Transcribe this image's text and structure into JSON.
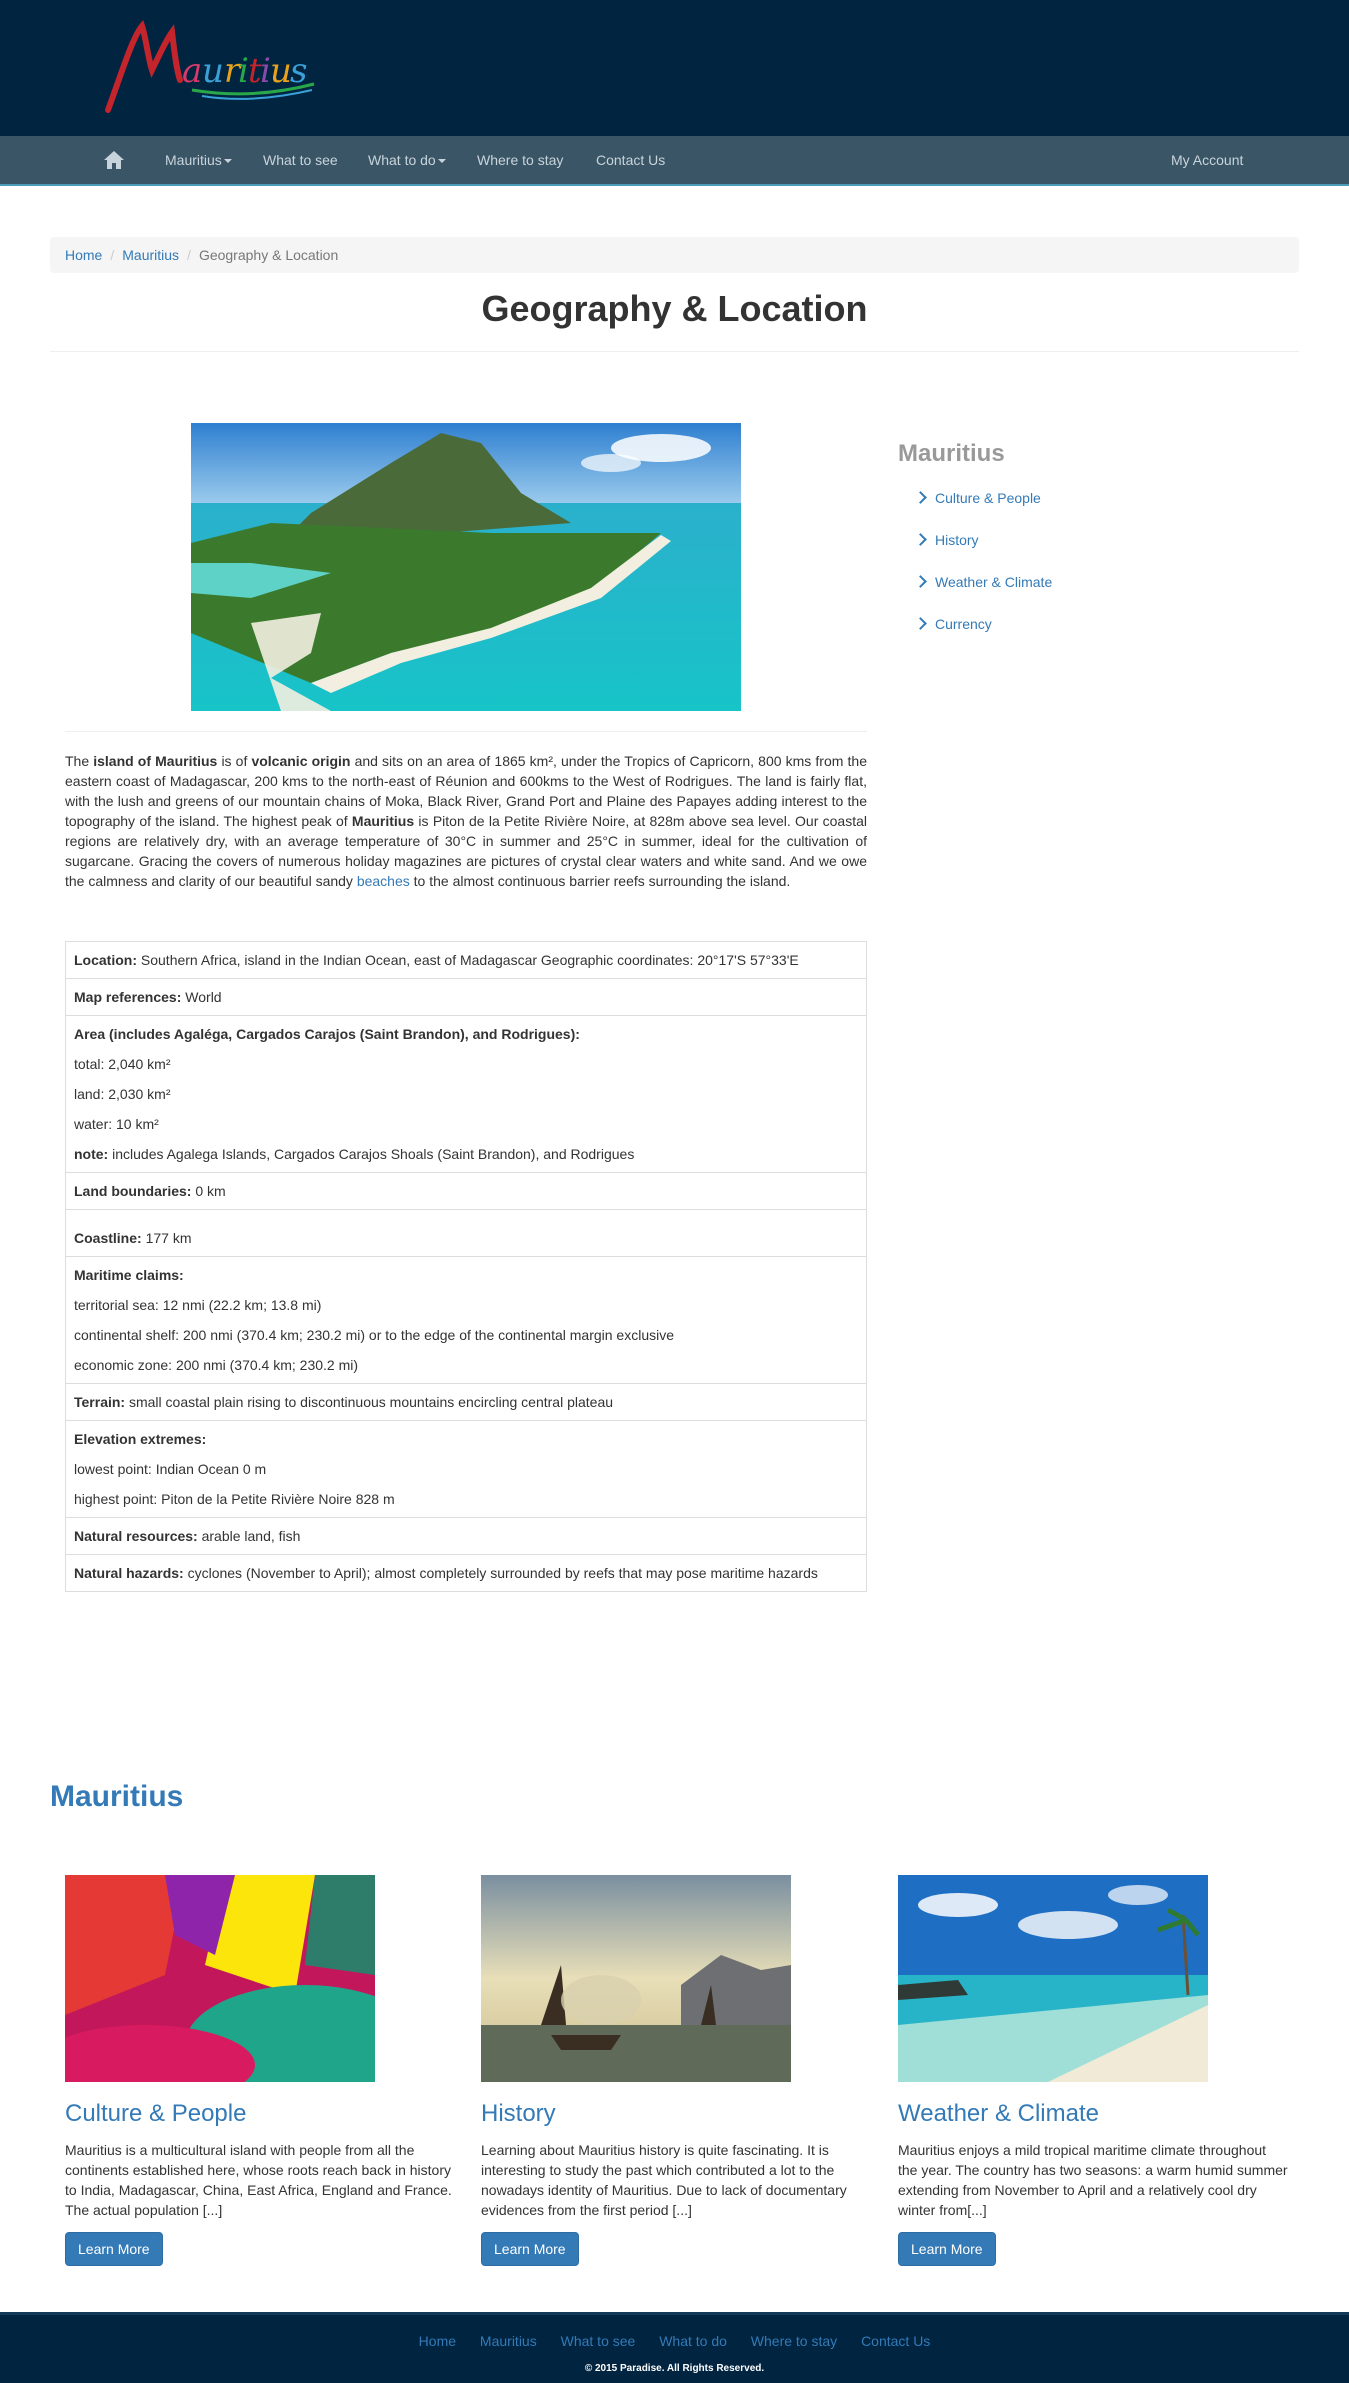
{
  "header": {
    "logo_text": "Mauritius"
  },
  "nav": {
    "items": [
      {
        "label": "Mauritius"
      },
      {
        "label": "What to see"
      },
      {
        "label": "What to do"
      },
      {
        "label": "Where to stay"
      },
      {
        "label": "Contact Us"
      }
    ],
    "account_label": "My Account"
  },
  "breadcrumb": {
    "items": [
      "Home",
      "Mauritius"
    ],
    "active": "Geography & Location",
    "separator": "/"
  },
  "page_title": "Geography & Location",
  "intro": {
    "p1": "The ",
    "b1": "island of Mauritius",
    "p2": " is of ",
    "b2": "volcanic origin",
    "p3": " and sits on an area of 1865 km², under the Tropics of Capricorn, 800 kms from the eastern coast of Madagascar, 200 kms to the north-east of Réunion and 600kms to the West of Rodrigues. The land is fairly flat, with the lush and greens of our mountain chains of Moka, Black River, Grand Port and Plaine des Papayes adding interest to the topography of the island. The highest peak of ",
    "b3": "Mauritius",
    "p4": " is Piton de la Petite Rivière Noire, at 828m above sea level. Our coastal regions are relatively dry, with an average temperature of 30°C in summer and 25°C in summer, ideal for the cultivation of sugarcane. Gracing the covers of numerous holiday magazines are pictures of crystal clear waters and white sand. And we owe the calmness and clarity of our beautiful sandy ",
    "link": "beaches",
    "p5": " to the almost continuous barrier reefs surrounding the island."
  },
  "facts": {
    "location": {
      "label": "Location:",
      "value": " Southern Africa, island in the Indian Ocean, east of Madagascar Geographic coordinates: 20°17'S 57°33'E"
    },
    "map_refs": {
      "label": "Map references:",
      "value": " World"
    },
    "area": {
      "label": "Area (includes Agaléga, Cargados Carajos (Saint Brandon), and Rodrigues):",
      "total": "total: 2,040 km²",
      "land": "land: 2,030 km²",
      "water": "water: 10 km²",
      "note_label": "note:",
      "note_value": " includes Agalega Islands, Cargados Carajos Shoals (Saint Brandon), and Rodrigues"
    },
    "land_boundaries": {
      "label": "Land boundaries:",
      "value": " 0 km"
    },
    "coastline": {
      "label": "Coastline:",
      "value": " 177 km"
    },
    "maritime": {
      "label": "Maritime claims:",
      "territorial": "territorial sea: 12 nmi (22.2 km; 13.8 mi)",
      "shelf": "continental shelf: 200 nmi (370.4 km; 230.2 mi) or to the edge of the continental margin exclusive",
      "economic": "economic zone: 200 nmi (370.4 km; 230.2 mi)"
    },
    "terrain": {
      "label": "Terrain:",
      "value": " small coastal plain rising to discontinuous mountains encircling central plateau"
    },
    "elevation": {
      "label": "Elevation extremes:",
      "lowest": "lowest point: Indian Ocean 0 m",
      "highest": "highest point: Piton de la Petite Rivière Noire 828 m"
    },
    "resources": {
      "label": "Natural resources:",
      "value": " arable land, fish"
    },
    "hazards": {
      "label": "Natural hazards:",
      "value": " cyclones (November to April); almost completely surrounded by reefs that may pose maritime hazards"
    }
  },
  "sidebar": {
    "title": "Mauritius",
    "links": [
      "Culture & People",
      "History",
      "Weather & Climate",
      "Currency"
    ]
  },
  "section": {
    "title": "Mauritius",
    "cards": [
      {
        "title": "Culture & People",
        "text": "Mauritius is a multicultural island with people from all the continents established here, whose roots reach back in history to India, Madagascar, China, East Africa, England and France. The actual population [...]",
        "button": "Learn More"
      },
      {
        "title": "History",
        "text": "Learning about Mauritius history is quite fascinating. It is interesting to study the past which contributed a lot to the nowadays identity of Mauritius. Due to lack of documentary evidences from the first period [...]",
        "button": "Learn More"
      },
      {
        "title": "Weather & Climate",
        "text": "Mauritius enjoys a mild tropical maritime climate throughout the year. The country has two seasons: a warm humid summer extending from November to April and a relatively cool dry winter from[...]",
        "button": "Learn More"
      }
    ]
  },
  "footer": {
    "links": [
      "Home",
      "Mauritius",
      "What to see",
      "What to do",
      "Where to stay",
      "Contact Us"
    ],
    "copyright": "© 2015 Paradise. All Rights Reserved."
  },
  "colors": {
    "header_bg": "#012440",
    "nav_bg": "#3a5565",
    "link": "#337ab7",
    "button": "#337ab7"
  }
}
